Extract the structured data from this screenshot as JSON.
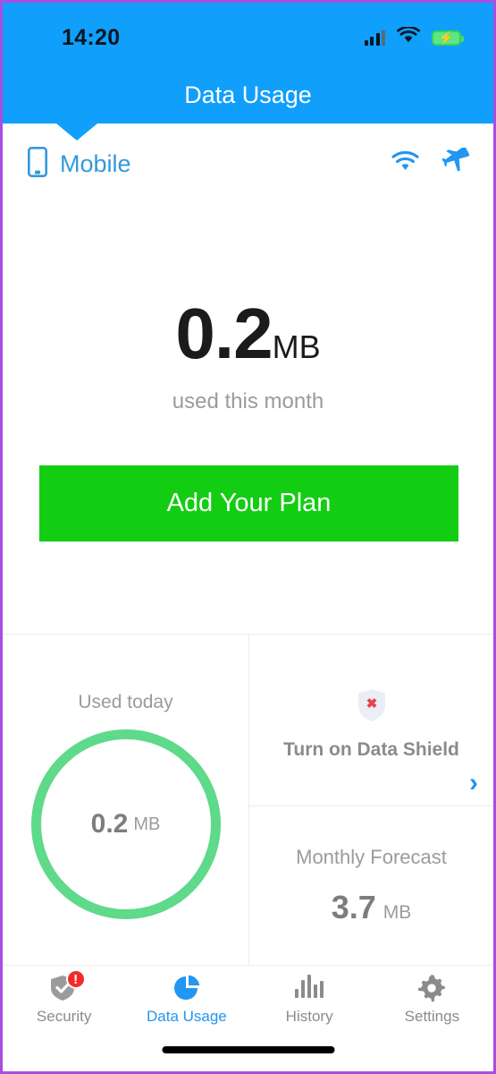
{
  "statusbar": {
    "time": "14:20",
    "signal_icon": "signal-bars-icon",
    "wifi_icon": "wifi-icon",
    "battery_icon": "battery-charging-icon",
    "bolt_glyph": "⚡"
  },
  "header": {
    "title": "Data Usage",
    "background": "#109ffb"
  },
  "connection_row": {
    "phone_icon": "smartphone-icon",
    "label": "Mobile",
    "wifi_icon": "wifi-icon",
    "airplane_icon": "airplane-mode-icon",
    "accent": "#3598dc"
  },
  "usage": {
    "amount": "0.2",
    "unit": "MB",
    "caption": "used this month"
  },
  "cta": {
    "label": "Add Your Plan",
    "color": "#13cd13"
  },
  "cards": {
    "used_today": {
      "label": "Used today",
      "value": "0.2",
      "unit": "MB",
      "ring_color": "#5fd98a"
    },
    "data_shield": {
      "icon": "shield-x-icon",
      "x_glyph": "✖",
      "label": "Turn on Data Shield",
      "chevron": "›"
    },
    "forecast": {
      "label": "Monthly Forecast",
      "value": "3.7",
      "unit": "MB"
    }
  },
  "navbar": {
    "items": [
      {
        "label": "Security",
        "icon": "shield-check-icon",
        "badge": "!",
        "active": false
      },
      {
        "label": "Data Usage",
        "icon": "pie-chart-icon",
        "active": true
      },
      {
        "label": "History",
        "icon": "bar-chart-icon",
        "active": false
      },
      {
        "label": "Settings",
        "icon": "gear-icon",
        "active": false
      }
    ],
    "active_color": "#2196f3",
    "inactive_color": "#8b8b8b"
  }
}
